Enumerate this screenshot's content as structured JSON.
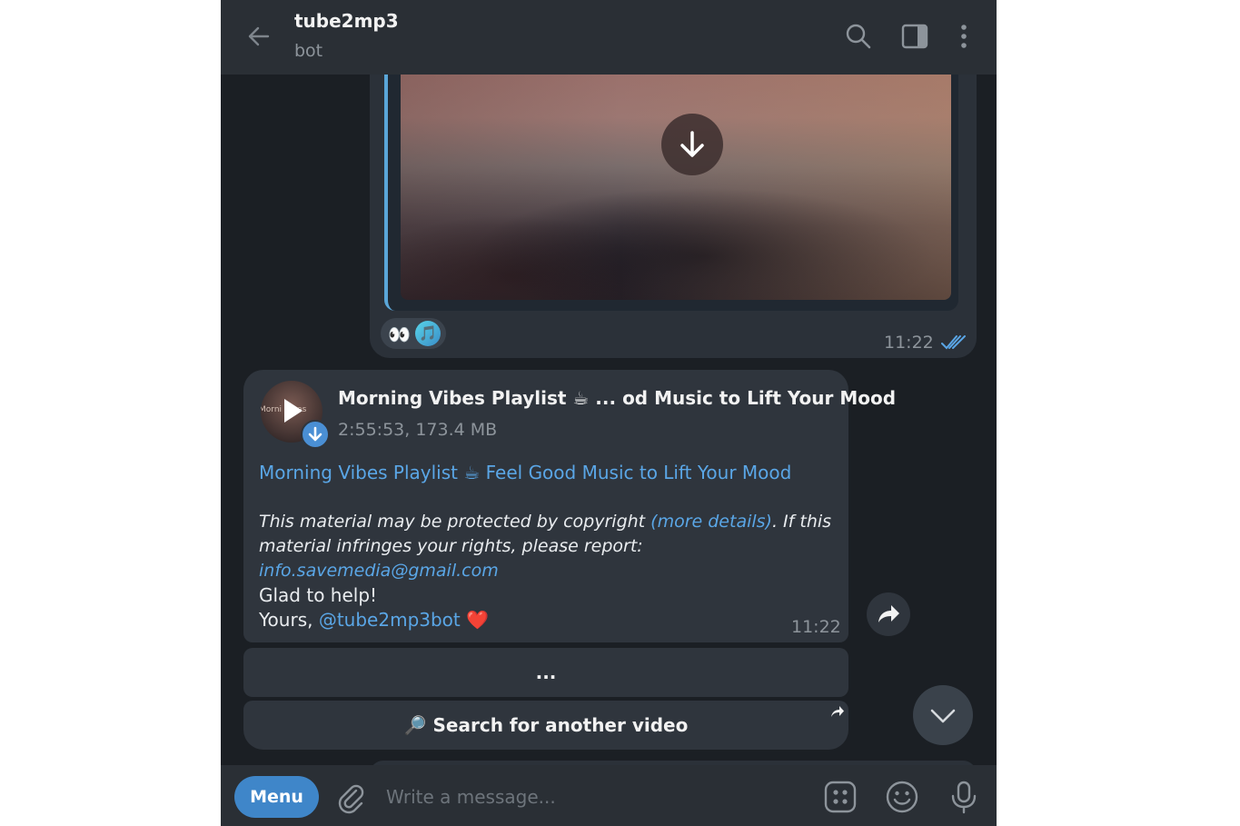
{
  "header": {
    "title": "tube2mp3",
    "subtitle": "bot"
  },
  "media_message": {
    "reactions": [
      "👀",
      "🎵"
    ],
    "time": "11:22",
    "status": "read"
  },
  "file_message": {
    "file_title": "Morning Vibes Playlist ☕ ... od Music to Lift Your Mood",
    "thumb_text": "Morni  Vibes",
    "file_meta": "2:55:53, 173.4 MB",
    "link_title": "Morning Vibes Playlist ☕ Feel Good Music to Lift Your Mood",
    "copyright_part1": "This material may be protected by copyright ",
    "copyright_link": "(more details)",
    "copyright_part2": ". If this material infringes your rights, please report: ",
    "copyright_email": "info.savemedia@gmail.com",
    "thanks": "Glad to help!",
    "sign_prefix": "Yours, ",
    "sign_handle": "@tube2mp3bot",
    "sign_emoji": "❤️",
    "time": "11:22"
  },
  "keyboard": {
    "more_label": "...",
    "search_label": "🔎 Search for another video"
  },
  "composer": {
    "menu_label": "Menu",
    "placeholder": "Write a message..."
  },
  "colors": {
    "accent": "#3f86c9",
    "link": "#5aa6e6",
    "background": "#1b1f24",
    "bubble": "#2f353d"
  }
}
